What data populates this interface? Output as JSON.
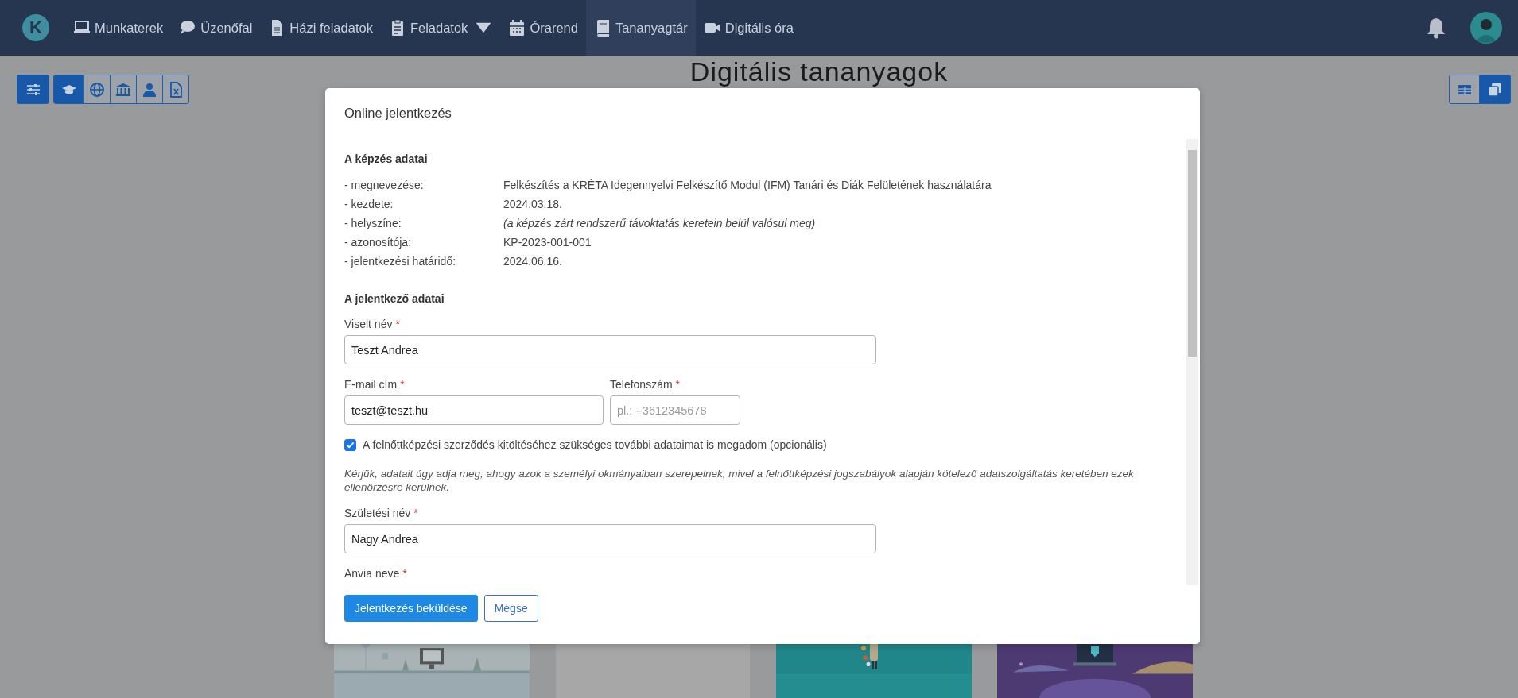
{
  "nav": {
    "logo": "K",
    "items": [
      {
        "label": "Munkaterek",
        "selected": false,
        "dropdown": false
      },
      {
        "label": "Üzenőfal",
        "selected": false,
        "dropdown": false
      },
      {
        "label": "Házi feladatok",
        "selected": false,
        "dropdown": false
      },
      {
        "label": "Feladatok",
        "selected": false,
        "dropdown": true
      },
      {
        "label": "Órarend",
        "selected": false,
        "dropdown": false
      },
      {
        "label": "Tananyagtár",
        "selected": true,
        "dropdown": false
      },
      {
        "label": "Digitális óra",
        "selected": false,
        "dropdown": false
      }
    ]
  },
  "toolbar": {
    "filter_selected": true,
    "types": [
      {
        "selected": true
      },
      {
        "selected": false
      },
      {
        "selected": false
      },
      {
        "selected": false
      },
      {
        "selected": false
      }
    ],
    "views": [
      {
        "selected": false
      },
      {
        "selected": true
      }
    ]
  },
  "page_title": "Digitális tananyagok",
  "cards": [
    {
      "kind": "office"
    },
    {
      "kind": "blank"
    },
    {
      "kind": "teal"
    },
    {
      "kind": "purple"
    }
  ],
  "modal": {
    "title": "Online jelentkezés",
    "course_heading": "A képzés adatai",
    "course_details": [
      {
        "label": "- megnevezése:",
        "value": "Felkészítés a KRÉTA Idegennyelvi Felkészítő Modul (IFM) Tanári és Diák Felületének használatára",
        "italic": false
      },
      {
        "label": "- kezdete:",
        "value": "2024.03.18.",
        "italic": false
      },
      {
        "label": "- helyszíne:",
        "value": "(a képzés zárt rendszerű távoktatás keretein belül valósul meg)",
        "italic": true
      },
      {
        "label": "- azonosítója:",
        "value": "KP-2023-001-001",
        "italic": false
      },
      {
        "label": "- jelentkezési határidő:",
        "value": "2024.06.16.",
        "italic": false
      }
    ],
    "applicant_heading": "A jelentkező adatai",
    "form": [
      {
        "kind": "fields",
        "fields": [
          {
            "label": "Viselt név",
            "marker": "*",
            "value": "Teszt Andrea"
          }
        ]
      },
      {
        "kind": "fields",
        "fields": [
          {
            "label": "E-mail cím",
            "marker": "*",
            "value": "teszt@teszt.hu"
          },
          {
            "label": "Telefonszám",
            "marker": "*",
            "placeholder": "pl.: +3612345678"
          }
        ]
      },
      {
        "kind": "checkbox",
        "label": "A felnőttképzési szerződés kitöltéséhez szükséges további adataimat is megadom (opcionális)",
        "checked": true
      },
      {
        "kind": "note",
        "text": "Kérjük, adatait úgy adja meg, ahogy azok a személyi okmányaiban szerepelnek, mivel a felnőttképzési jogszabályok alapján kötelező adatszolgáltatás keretében ezek ellenőrzésre kerülnek."
      },
      {
        "kind": "fields",
        "fields": [
          {
            "label": "Születési név",
            "marker": "*",
            "value": "Nagy Andrea"
          }
        ]
      },
      {
        "kind": "fields",
        "fields": [
          {
            "label": "Anvia neve",
            "marker": "*"
          }
        ]
      }
    ],
    "buttons": [
      {
        "label": "Jelentkezés beküldése",
        "kind": "primary"
      },
      {
        "label": "Mégse",
        "kind": "secondary"
      }
    ]
  }
}
